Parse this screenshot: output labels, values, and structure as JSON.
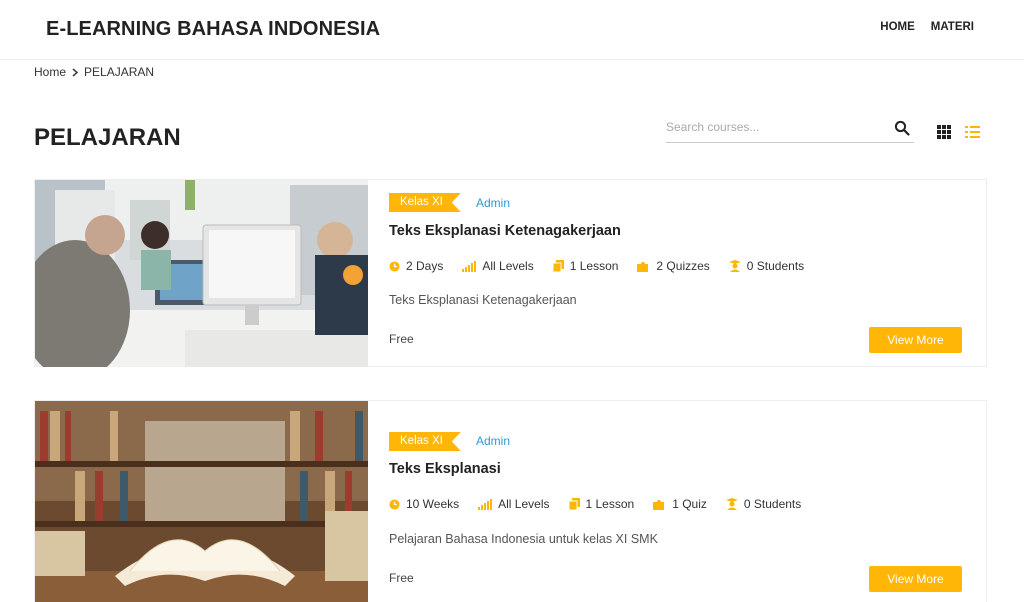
{
  "header": {
    "site_title": "E-LEARNING BAHASA INDONESIA",
    "nav": [
      {
        "label": "HOME"
      },
      {
        "label": "MATERI"
      }
    ]
  },
  "breadcrumb": {
    "home": "Home",
    "current": "PELAJARAN"
  },
  "page": {
    "title": "PELAJARAN"
  },
  "search": {
    "placeholder": "Search courses..."
  },
  "colors": {
    "accent": "#ffb606",
    "author_link": "#2c9ad6"
  },
  "courses": [
    {
      "category": "Kelas XI",
      "author": "Admin",
      "title": "Teks Eksplanasi Ketenagakerjaan",
      "meta": {
        "duration": "2 Days",
        "level": "All Levels",
        "lessons": "1 Lesson",
        "quizzes": "2 Quizzes",
        "students": "0 Students"
      },
      "description": "Teks Eksplanasi Ketenagakerjaan",
      "price": "Free",
      "button": "View More"
    },
    {
      "category": "Kelas XI",
      "author": "Admin",
      "title": "Teks Eksplanasi",
      "meta": {
        "duration": "10 Weeks",
        "level": "All Levels",
        "lessons": "1 Lesson",
        "quizzes": "1 Quiz",
        "students": "0 Students"
      },
      "description": "Pelajaran Bahasa Indonesia untuk kelas XI SMK",
      "price": "Free",
      "button": "View More"
    }
  ]
}
